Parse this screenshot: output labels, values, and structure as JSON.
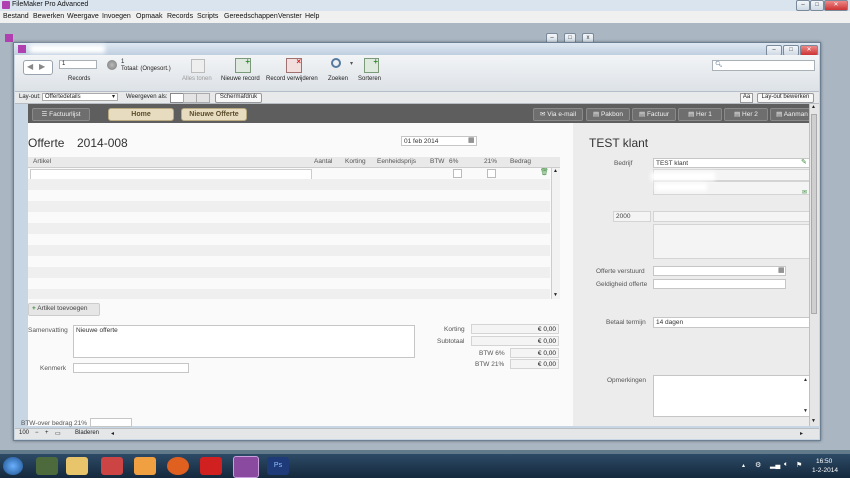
{
  "app": {
    "title": "FileMaker Pro Advanced"
  },
  "menubar": [
    "Bestand",
    "Bewerken",
    "Weergave",
    "Invoegen",
    "Opmaak",
    "Records",
    "Scripts",
    "Gereedschappen",
    "Venster",
    "Help"
  ],
  "toolbar": {
    "record_number": "1",
    "record_count": "1",
    "total_label": "Totaal: (Ongesort.)",
    "records_label": "Records",
    "show_all": "Alles tonen",
    "new_record": "Nieuwe record",
    "delete_record": "Record verwijderen",
    "find": "Zoeken",
    "sort": "Sorteren"
  },
  "layoutbar": {
    "layout_label": "Lay-out:",
    "layout_value": "Offertedetails",
    "view_as_label": "Weergeven als:",
    "preview_button": "Schermafdruk",
    "font_button": "Aa",
    "edit_layout_button": "Lay-out bewerken"
  },
  "navbar": {
    "invoice_list": "Factuurlijst",
    "home": "Home",
    "new_quote": "Nieuwe Offerte",
    "via_email": "Via e-mail",
    "packing_slip": "Pakbon",
    "invoice": "Factuur",
    "reminder1": "Her 1",
    "reminder2": "Her 2",
    "summons": "Aanman"
  },
  "quote": {
    "title_label": "Offerte",
    "number": "2014-008",
    "date": "01 feb 2014"
  },
  "table": {
    "headers": {
      "article": "Artikel",
      "qty": "Aantal",
      "discount": "Korting",
      "unit_price": "Eenheidsprijs",
      "vat": "BTW",
      "vat6": "6%",
      "vat21": "21%",
      "amount": "Bedrag"
    },
    "add_article": "Artikel toevoegen"
  },
  "summary": {
    "summary_label": "Samenvatting",
    "summary_value": "Nieuwe offerte",
    "reference_label": "Kenmerk",
    "discount_label": "Korting",
    "discount_value": "€ 0,00",
    "subtotal_label": "Subtotaal",
    "subtotal_value": "€ 0,00",
    "vat6_label": "BTW 6%",
    "vat6_value": "€ 0,00",
    "vat21_label": "BTW 21%",
    "vat21_value": "€ 0,00",
    "vat_over_label": "BTW-over bedrag 21%"
  },
  "client": {
    "name": "TEST klant",
    "company_label": "Bedrijf",
    "company_value": "TEST klant",
    "postcode": "2000",
    "sent_label": "Offerte verstuurd",
    "valid_label": "Geldigheid offerte",
    "terms_label": "Betaal termijn",
    "terms_value": "14 dagen",
    "notes_label": "Opmerkingen"
  },
  "statusbar": {
    "zoom": "100",
    "mode": "Bladeren"
  },
  "taskbar": {
    "time": "16:50",
    "date": "1-2-2014"
  }
}
